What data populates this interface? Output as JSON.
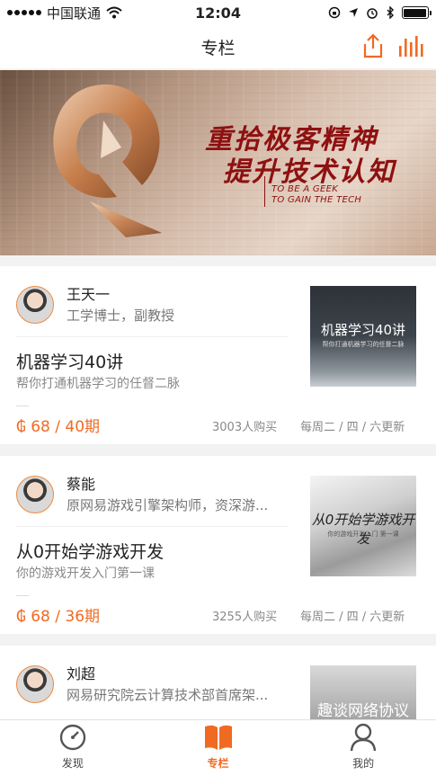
{
  "status_bar": {
    "carrier": "中国联通",
    "time": "12:04"
  },
  "nav": {
    "title": "专栏"
  },
  "banner": {
    "headline1": "重拾极客精神",
    "headline2": "提升技术认知",
    "english1": "TO BE A GEEK",
    "english2": "TO GAIN THE TECH"
  },
  "courses": [
    {
      "author_name": "王天一",
      "author_title": "工学博士，副教授",
      "title": "机器学习40讲",
      "subtitle": "帮你打通机器学习的任督二脉",
      "price": "₲ 68 / 40期",
      "buyers": "3003人购买",
      "schedule": "每周二 / 四 / 六更新",
      "cover_title": "机器学习40讲",
      "cover_sub": "帮你打通机器学习的任督二脉"
    },
    {
      "author_name": "蔡能",
      "author_title": "原网易游戏引擎架构师，资深游...",
      "title": "从0开始学游戏开发",
      "subtitle": "你的游戏开发入门第一课",
      "price": "₲ 68 / 36期",
      "buyers": "3255人购买",
      "schedule": "每周二 / 四 / 六更新",
      "cover_title": "从0开始学游戏开发",
      "cover_sub": "你的游戏开发入门 第一课"
    },
    {
      "author_name": "刘超",
      "author_title": "网易研究院云计算技术部首席架...",
      "cover_title": "趣谈网络协议"
    }
  ],
  "tabs": [
    {
      "label": "发现",
      "icon": "discover-icon"
    },
    {
      "label": "专栏",
      "icon": "book-icon"
    },
    {
      "label": "我的",
      "icon": "profile-icon"
    }
  ],
  "colors": {
    "accent": "#f06a22",
    "banner_text": "#8e1010"
  }
}
